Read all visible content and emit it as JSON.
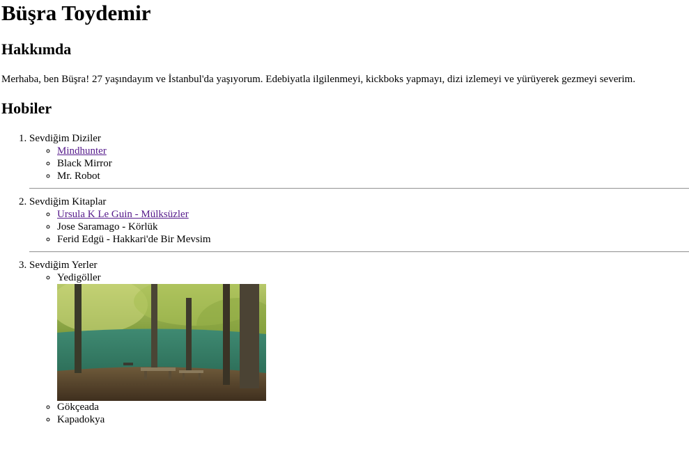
{
  "page": {
    "name": "Büşra Toydemir",
    "about_heading": "Hakkımda",
    "about_text": "Merhaba, ben Büşra! 27 yaşındayım ve İstanbul'da yaşıyorum. Edebiyatla ilgilenmeyi, kickboks yapmayı, dizi izlemeyi ve yürüyerek gezmeyi severim.",
    "hobbies_heading": "Hobiler"
  },
  "hobbies": [
    {
      "title": "Sevdiğim Diziler",
      "items": [
        "Mindhunter",
        "Black Mirror",
        "Mr. Robot"
      ]
    },
    {
      "title": "Sevdiğim Kitaplar",
      "items": [
        "Ursula K Le Guin - Mülksüzler",
        "Jose Saramago - Körlük",
        "Ferid Edgü - Hakkari'de Bir Mevsim"
      ]
    },
    {
      "title": "Sevdiğim Yerler",
      "items": [
        "Yedigöller",
        "Gökçeada",
        "Kapadokya"
      ]
    }
  ],
  "colors": {
    "link_visited": "#551a8b",
    "divider": "#9a9a9a"
  }
}
